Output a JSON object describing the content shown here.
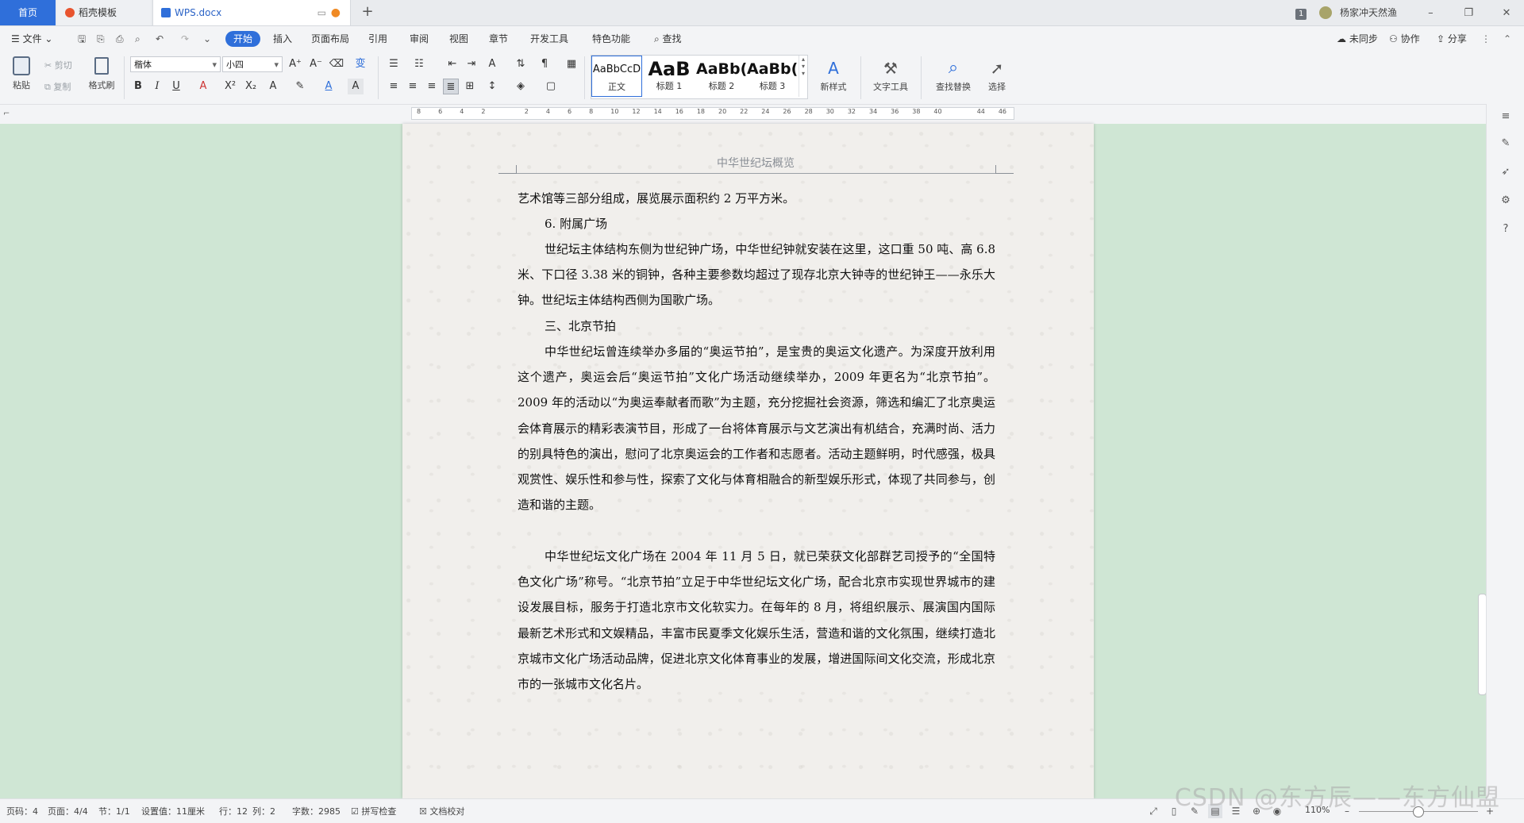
{
  "tabs": {
    "home": "首页",
    "templates": "稻壳模板",
    "doc": "WPS.docx",
    "add": "+"
  },
  "user": {
    "badge": "1",
    "name": "杨家冲天然渔"
  },
  "window": {
    "minimize": "–",
    "restore": "❐",
    "close": "✕"
  },
  "menu": {
    "file": "文件",
    "items": [
      "开始",
      "插入",
      "页面布局",
      "引用",
      "审阅",
      "视图",
      "章节",
      "开发工具",
      "特色功能"
    ],
    "search": "查找",
    "sync": "未同步",
    "collab": "协作",
    "share": "分享"
  },
  "ribbon": {
    "paste": "粘贴",
    "cut": "剪切",
    "copy": "复制",
    "format_painter": "格式刷",
    "font_name": "楷体",
    "font_size": "小四",
    "styles": [
      {
        "preview": "AaBbCcD",
        "name": "正文"
      },
      {
        "preview": "AaB",
        "name": "标题 1"
      },
      {
        "preview": "AaBb(",
        "name": "标题 2"
      },
      {
        "preview": "AaBb(",
        "name": "标题 3"
      }
    ],
    "new_style": "新样式",
    "text_tools": "文字工具",
    "find_replace": "查找替换",
    "select": "选择"
  },
  "ruler": {
    "ticks": [
      "8",
      "6",
      "4",
      "2",
      "",
      "2",
      "4",
      "6",
      "8",
      "10",
      "12",
      "14",
      "16",
      "18",
      "20",
      "22",
      "24",
      "26",
      "28",
      "30",
      "32",
      "34",
      "36",
      "38",
      "40",
      "",
      "44",
      "46"
    ]
  },
  "document": {
    "header": "中华世纪坛概览",
    "paragraphs": [
      "艺术馆等三部分组成，展览展示面积约 2 万平方米。",
      "6.  附属广场",
      "世纪坛主体结构东侧为世纪钟广场，中华世纪钟就安装在这里，这口重 50 吨、高 6.8 米、下口径 3.38 米的铜钟，各种主要参数均超过了现存北京大钟寺的世纪钟王——永乐大钟。世纪坛主体结构西侧为国歌广场。",
      "三、北京节拍",
      "中华世纪坛曾连续举办多届的“奥运节拍”，是宝贵的奥运文化遗产。为深度开放利用这个遗产，奥运会后“奥运节拍”文化广场活动继续举办，2009 年更名为“北京节拍”。2009 年的活动以“为奥运奉献者而歌”为主题，充分挖掘社会资源，筛选和编汇了北京奥运会体育展示的精彩表演节目，形成了一台将体育展示与文艺演出有机结合，充满时尚、活力的别具特色的演出，慰问了北京奥运会的工作者和志愿者。活动主题鲜明，时代感强，极具观赏性、娱乐性和参与性，探索了文化与体育相融合的新型娱乐形式，体现了共同参与，创造和谐的主题。",
      "中华世纪坛文化广场在 2004 年 11 月 5 日，就已荣获文化部群艺司授予的“全国特色文化广场”称号。“北京节拍”立足于中华世纪坛文化广场，配合北京市实现世界城市的建设发展目标，服务于打造北京市文化软实力。在每年的 8 月，将组织展示、展演国内国际最新艺术形式和文娱精品，丰富市民夏季文化娱乐生活，营造和谐的文化氛围，继续打造北京城市文化广场活动品牌，促进北京文化体育事业的发展，增进国际间文化交流，形成北京市的一张城市文化名片。"
    ]
  },
  "status": {
    "page_code": "页码：4",
    "pages": "页面：4/4",
    "section": "节：1/1",
    "setting": "设置值：11厘米",
    "row": "行：12",
    "col": "列：2",
    "words": "字数：2985",
    "spell": "拼写检查",
    "proof": "文档校对",
    "zoom": "110%"
  },
  "watermark": "CSDN @东方辰——东方仙盟",
  "colors": {
    "accent": "#2f6fda",
    "page_bg": "#f1efec",
    "doc_bg": "#cfe6d4"
  }
}
